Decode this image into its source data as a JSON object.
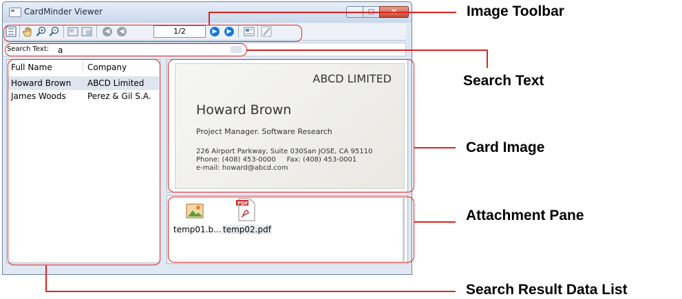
{
  "window": {
    "title": "CardMinder Viewer",
    "controls": {
      "minimize": "–",
      "maximize": "□",
      "close": "✕"
    }
  },
  "toolbar": {
    "page_indicator": "1/2",
    "icons": [
      "list-view-icon",
      "hand-tool-icon",
      "zoom-in-icon",
      "zoom-out-icon",
      "fit-page-icon",
      "fit-width-icon",
      "first-page-icon",
      "previous-page-icon",
      "next-page-icon",
      "last-page-icon",
      "card-list-icon",
      "edit-icon"
    ]
  },
  "search": {
    "label": "Search Text:",
    "value": "a"
  },
  "results": {
    "columns": [
      "Full Name",
      "Company"
    ],
    "rows": [
      {
        "name": "Howard Brown",
        "company": "ABCD Limited"
      },
      {
        "name": "James Woods",
        "company": "Perez & Gil S.A."
      }
    ]
  },
  "card": {
    "company": "ABCD LIMITED",
    "name": "Howard Brown",
    "title": "Project Manager. Software Research",
    "address": "226 Airport Parkway, Suite 030San JOSE, CA 95110",
    "phone_fax": "Phone: (408) 453-0000     Fax: (408) 453-0001",
    "email": "e-mail: howard@abcd.com"
  },
  "attachments": [
    {
      "name": "temp01.b...",
      "icon": "image-file-icon"
    },
    {
      "name": "temp02.pdf",
      "icon": "pdf-file-icon"
    }
  ],
  "callouts": {
    "image_toolbar": "Image Toolbar",
    "search_text": "Search Text",
    "card_image": "Card Image",
    "attachment_pane": "Attachment Pane",
    "search_result_list": "Search Result Data List"
  },
  "colors": {
    "callout_line": "#e02020",
    "accent_blue": "#1a78d8",
    "selected_row": "#dfe5ee"
  }
}
